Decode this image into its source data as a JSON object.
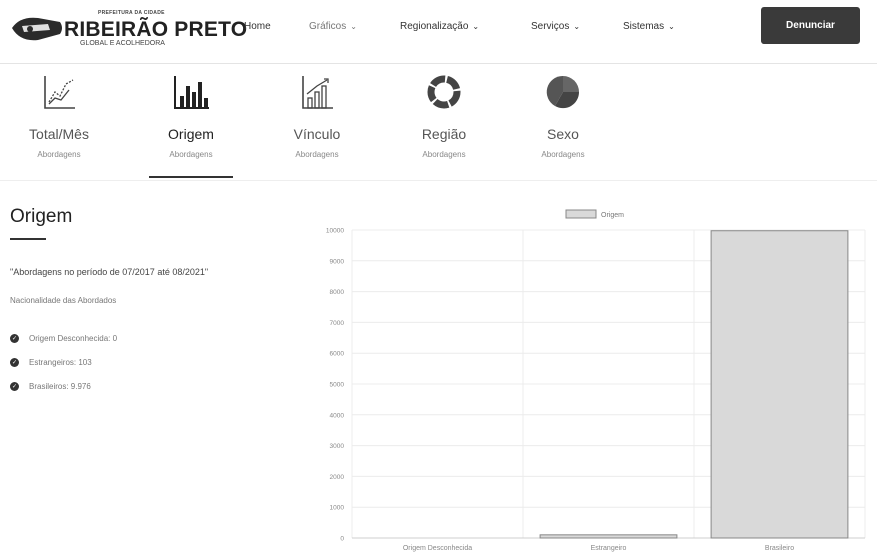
{
  "header": {
    "logo_small": "PREFEITURA DA CIDADE",
    "logo_main": "RIBEIRÃO PRETO",
    "logo_sub": "GLOBAL E ACOLHEDORA",
    "nav": [
      {
        "label": "Home",
        "has_dropdown": false
      },
      {
        "label": "Gráficos",
        "has_dropdown": true
      },
      {
        "label": "Regionalização",
        "has_dropdown": true
      },
      {
        "label": "Serviços",
        "has_dropdown": true
      },
      {
        "label": "Sistemas",
        "has_dropdown": true
      }
    ],
    "cta": "Denunciar"
  },
  "tabs": [
    {
      "label": "Total/Mês",
      "sub": "Abordagens",
      "icon": "line-chart-icon",
      "active": false
    },
    {
      "label": "Origem",
      "sub": "Abordagens",
      "icon": "bar-chart-icon",
      "active": true
    },
    {
      "label": "Vínculo",
      "sub": "Abordagens",
      "icon": "growth-chart-icon",
      "active": false
    },
    {
      "label": "Região",
      "sub": "Abordagens",
      "icon": "donut-chart-icon",
      "active": false
    },
    {
      "label": "Sexo",
      "sub": "Abordagens",
      "icon": "pie-chart-icon",
      "active": false
    }
  ],
  "section": {
    "title": "Origem",
    "period": "\"Abordagens no período de 07/2017 até 08/2021\"",
    "nat_label": "Nacionalidade das Abordados",
    "stats": [
      "Origem Desconhecida: 0",
      "Estrangeiros: 103",
      "Brasileiros: 9.976"
    ]
  },
  "colors": {
    "accent": "#3a3a3a",
    "bar_fill": "#d9d9d9",
    "bar_stroke": "#888888"
  },
  "chart_data": {
    "type": "bar",
    "legend": "Origem",
    "legend_position": "top-center",
    "categories": [
      "Origem Desconhecida",
      "Estrangeiro",
      "Brasileiro"
    ],
    "values": [
      0,
      103,
      9976
    ],
    "ylim": [
      0,
      10000
    ],
    "yticks": [
      "10000",
      "9000",
      "8000",
      "7000",
      "6000",
      "5000",
      "4000",
      "3000",
      "2000",
      "1000",
      "0"
    ],
    "grid": true
  }
}
